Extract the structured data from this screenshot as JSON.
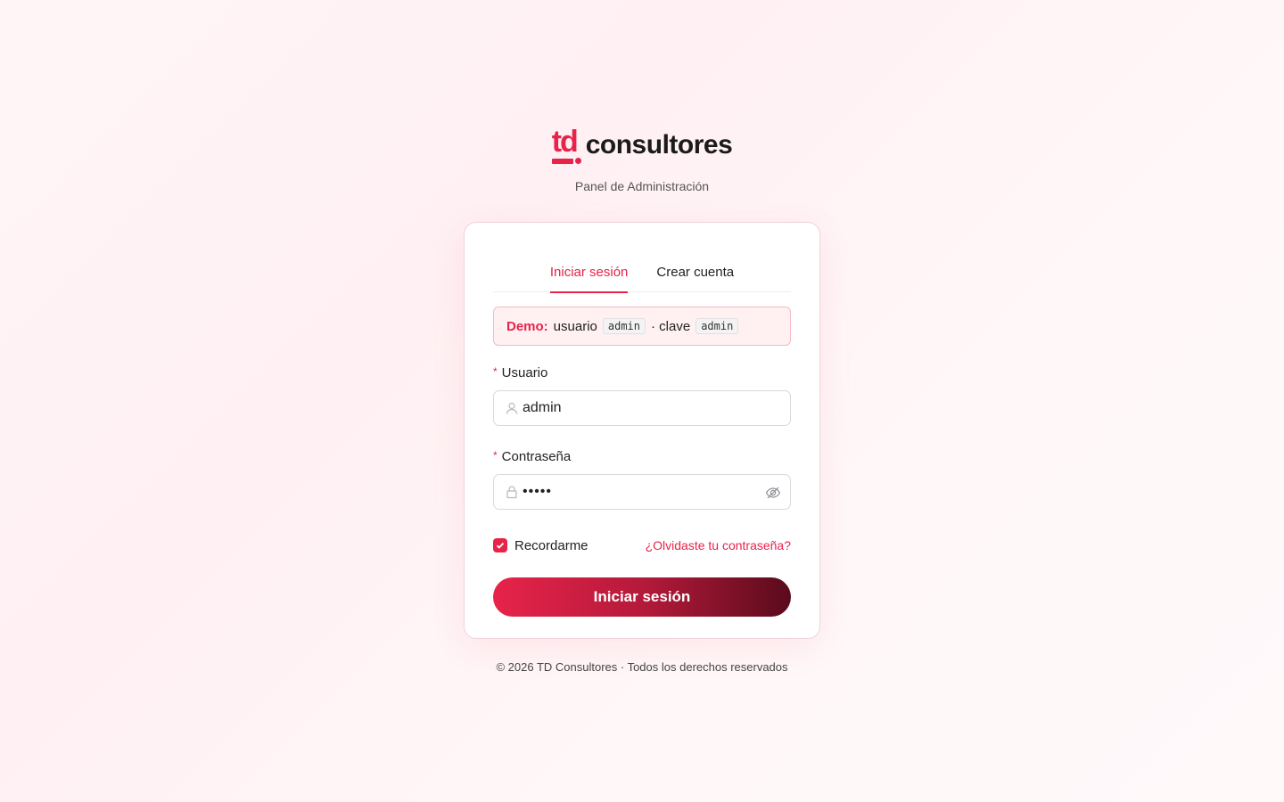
{
  "brand": {
    "logo_mark": "td",
    "logo_text": "consultores",
    "subtitle": "Panel de Administración",
    "accent_color": "#e8234a"
  },
  "tabs": [
    {
      "label": "Iniciar sesión",
      "active": true
    },
    {
      "label": "Crear cuenta",
      "active": false
    }
  ],
  "demo": {
    "label": "Demo:",
    "user_text": "usuario",
    "user_code": "admin",
    "separator_text": "· clave",
    "pass_code": "admin"
  },
  "form": {
    "username_label": "Usuario",
    "username_value": "admin",
    "password_label": "Contraseña",
    "password_masked": "•••••",
    "remember_label": "Recordarme",
    "remember_checked": true,
    "forgot_link": "¿Olvidaste tu contraseña?",
    "submit_label": "Iniciar sesión"
  },
  "icons": {
    "username": "user-icon",
    "password": "lock-icon",
    "toggle_visibility": "eye-slash-icon",
    "checkbox": "check-icon"
  },
  "footer": {
    "text": "© 2026 TD Consultores · Todos los derechos reservados"
  }
}
